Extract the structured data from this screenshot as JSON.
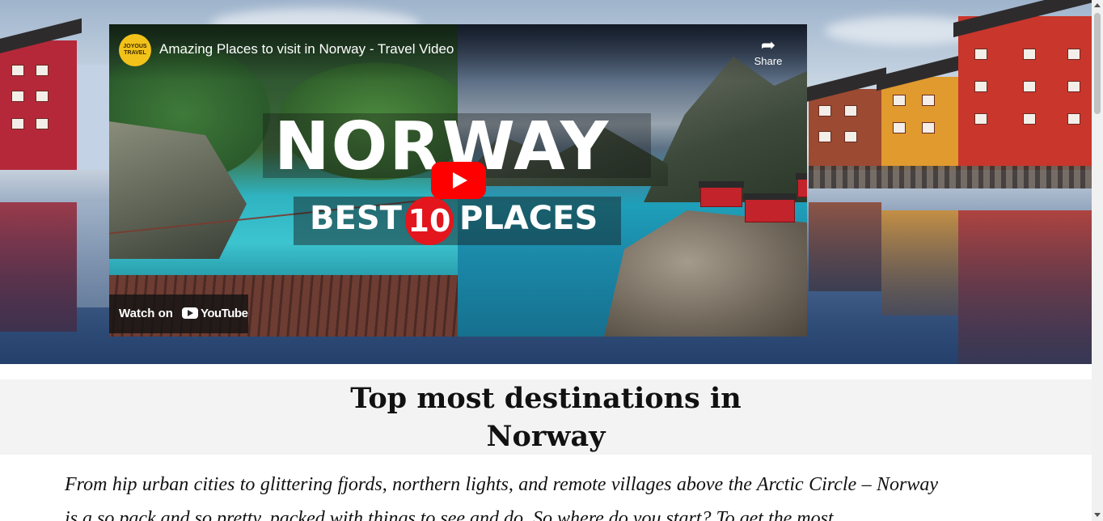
{
  "video": {
    "channel_logo_text": "JOYOUS TRAVEL",
    "title": "Amazing Places to visit in Norway - Travel Video",
    "share_label": "Share",
    "thumbnail_headline": "NORWAY",
    "thumbnail_best": "BEST",
    "thumbnail_number": "10",
    "thumbnail_places": "PLACES",
    "watch_on_label": "Watch on",
    "youtube_label": "YouTube"
  },
  "main": {
    "title": "Top most destinations in Norway",
    "intro": "From hip urban cities to glittering fjords, northern lights, and remote villages above the Arctic Circle – Norway is a so pack and so pretty, packed with things to see and do. So where do you start? To get the most"
  },
  "colors": {
    "play_button": "#ff0000",
    "heading_band": "#f3f3f3",
    "number_badge": "#e3161e"
  }
}
